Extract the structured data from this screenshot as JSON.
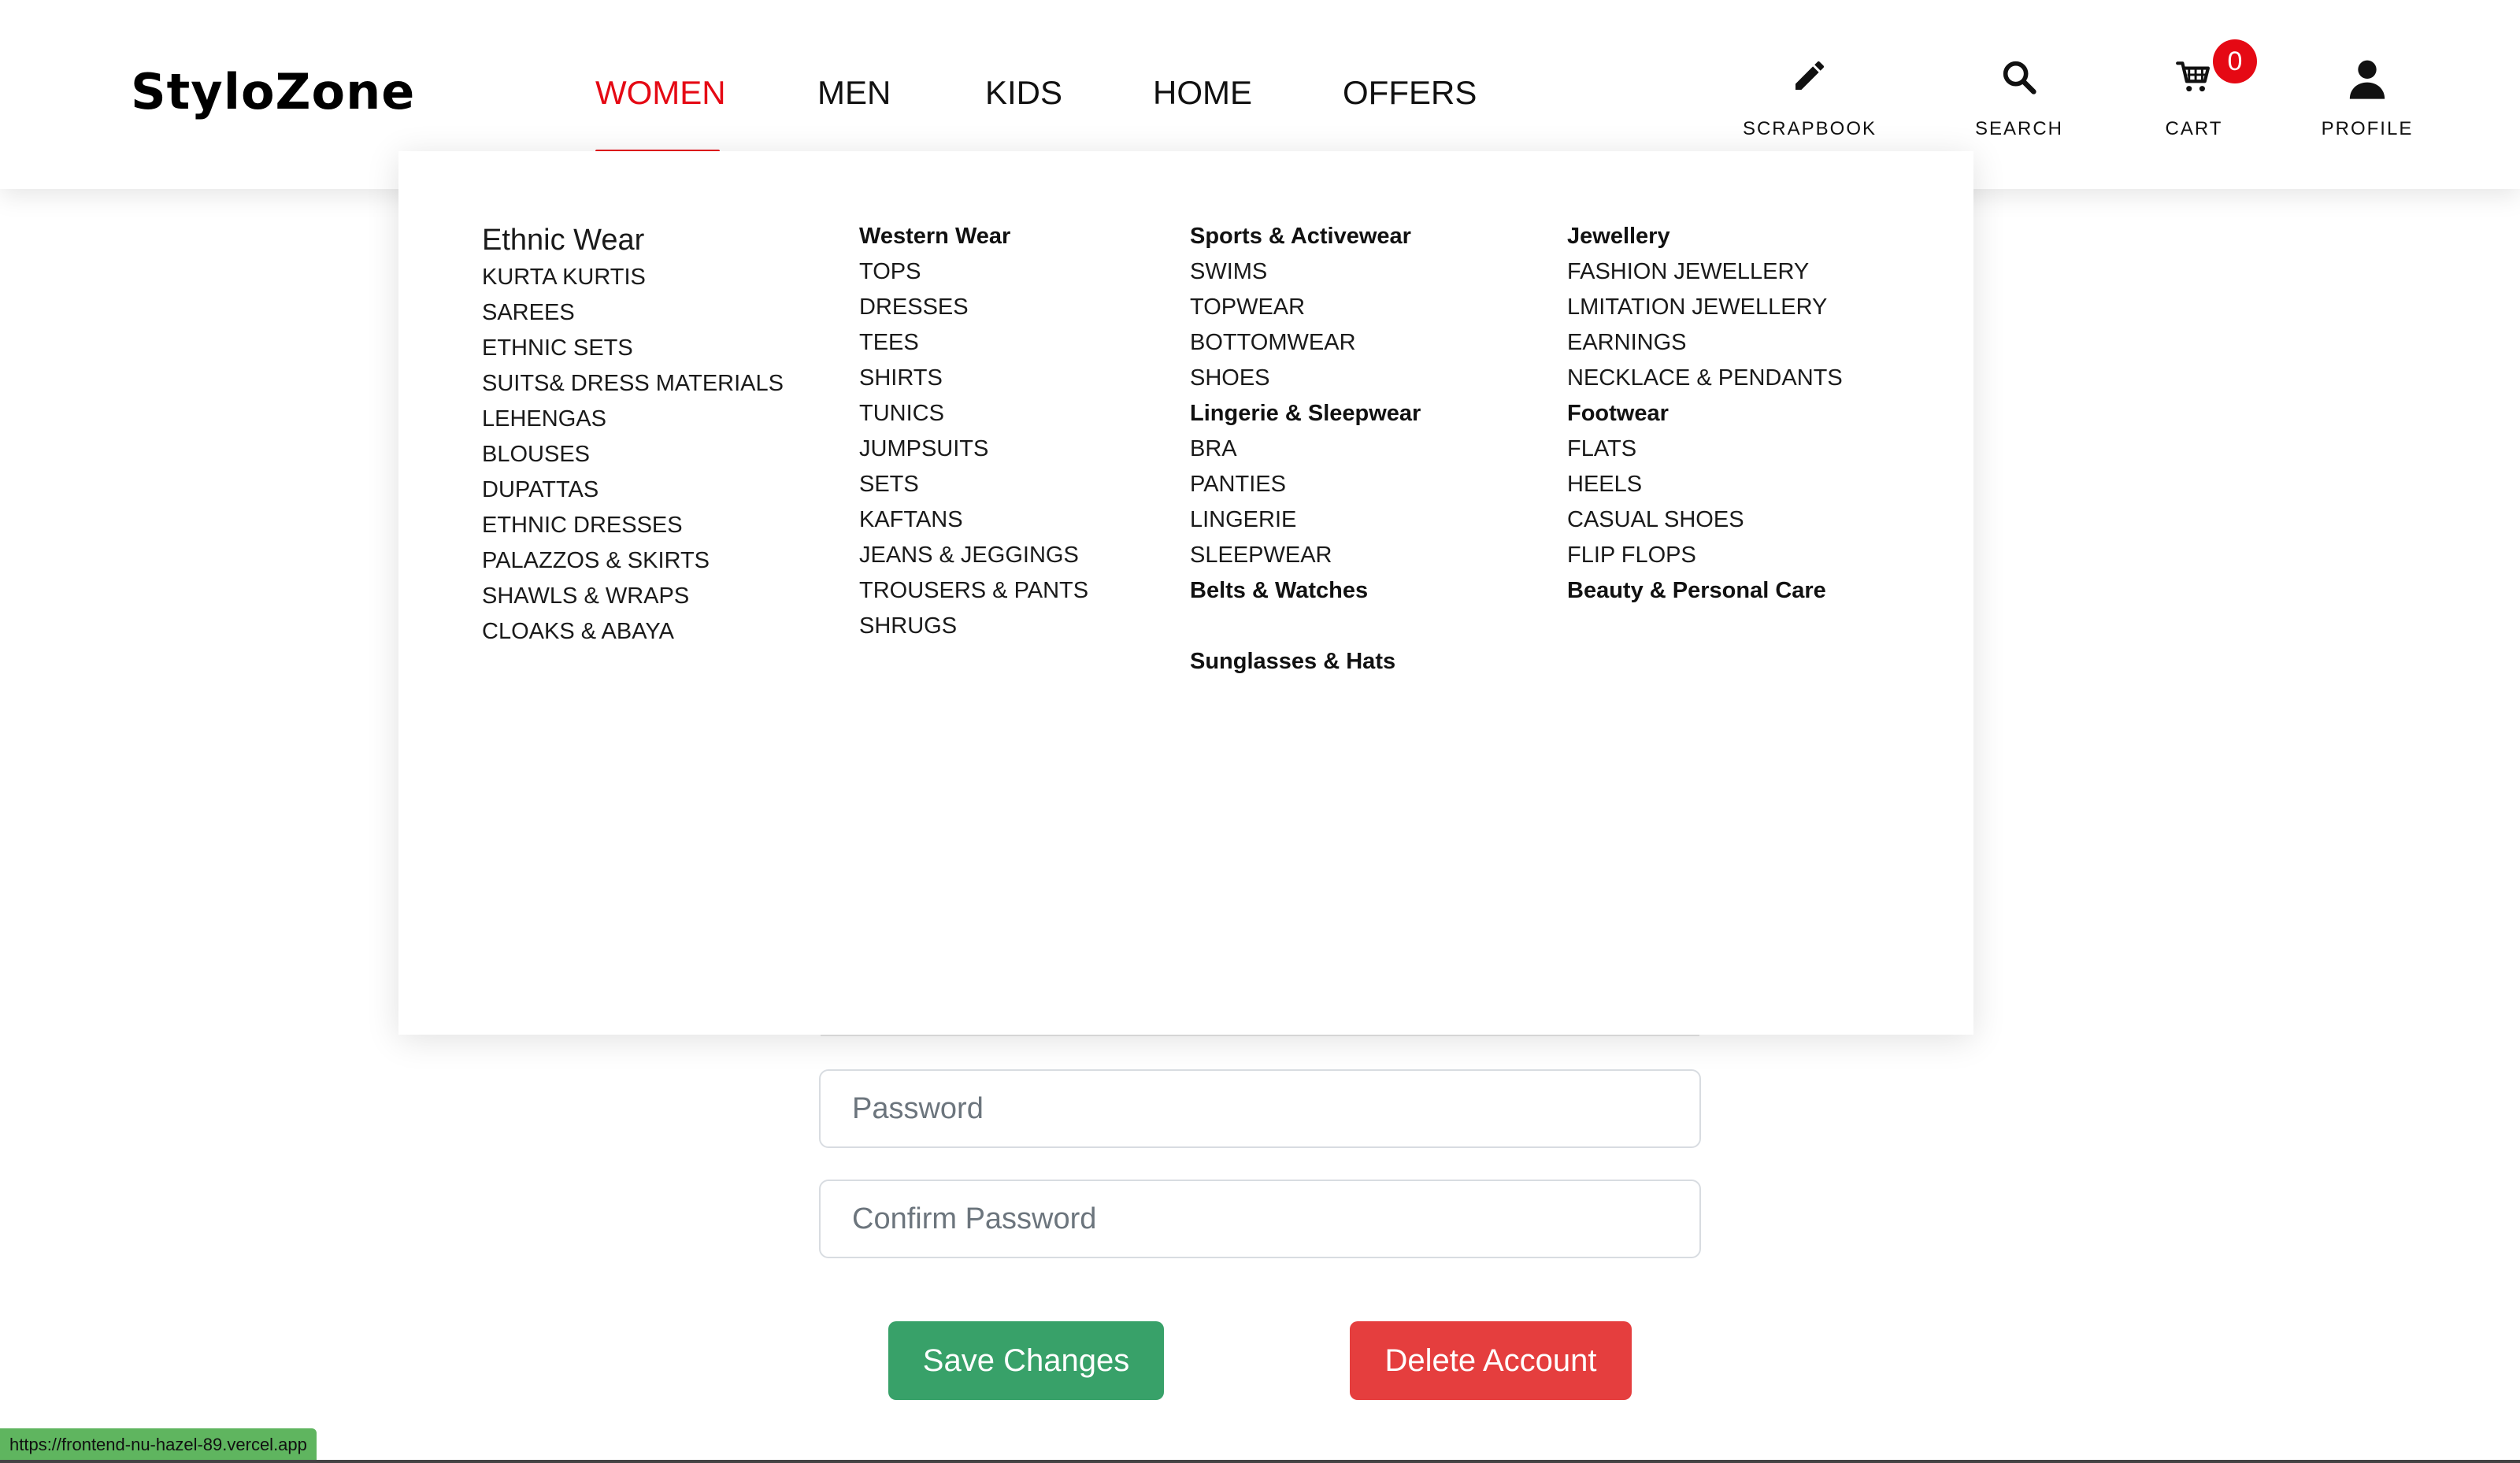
{
  "brand": {
    "name": "StyloZone",
    "accent": "#e50914"
  },
  "nav": {
    "items": [
      {
        "label": "WOMEN",
        "active": true
      },
      {
        "label": "MEN",
        "active": false
      },
      {
        "label": "KIDS",
        "active": false
      },
      {
        "label": "HOME",
        "active": false
      },
      {
        "label": "OFFERS",
        "active": false
      }
    ]
  },
  "actions": {
    "scrapbook": {
      "label": "SCRAPBOOK",
      "icon": "pencil-icon"
    },
    "search": {
      "label": "SEARCH",
      "icon": "search-icon"
    },
    "cart": {
      "label": "CART",
      "icon": "cart-icon",
      "count": "0"
    },
    "profile": {
      "label": "PROFILE",
      "icon": "user-icon"
    }
  },
  "mega_menu": {
    "columns": [
      {
        "heading": "Ethnic Wear",
        "items": [
          "KURTA KURTIS",
          "SAREES",
          "ETHNIC SETS",
          "SUITS& DRESS MATERIALS",
          "LEHENGAS",
          "BLOUSES",
          "DUPATTAS",
          "ETHNIC DRESSES",
          "PALAZZOS & SKIRTS",
          "SHAWLS & WRAPS",
          "CLOAKS & ABAYA"
        ]
      },
      {
        "heading": "Western Wear",
        "items": [
          "TOPS",
          "DRESSES",
          "TEES",
          "SHIRTS",
          "TUNICS",
          "JUMPSUITS",
          "SETS",
          "KAFTANS",
          "JEANS & JEGGINGS",
          "TROUSERS & PANTS",
          "SHRUGS"
        ]
      },
      {
        "heading": "Sports & Activewear",
        "items": [
          "SWIMS",
          "TOPWEAR",
          "BOTTOMWEAR",
          "SHOES"
        ],
        "heading2": "Lingerie & Sleepwear",
        "items2": [
          "BRA",
          "PANTIES",
          "LINGERIE",
          "SLEEPWEAR"
        ],
        "heading3": "Belts & Watches",
        "heading4": "Sunglasses & Hats"
      },
      {
        "heading": "Jewellery",
        "items": [
          "FASHION JEWELLERY",
          "LMITATION JEWELLERY",
          "EARNINGS",
          "NECKLACE & PENDANTS"
        ],
        "heading2": "Footwear",
        "items2": [
          "FLATS",
          "HEELS",
          "CASUAL SHOES",
          "FLIP FLOPS"
        ],
        "heading3": "Beauty & Personal Care"
      }
    ]
  },
  "form": {
    "password_placeholder": "Password",
    "confirm_placeholder": "Confirm Password",
    "save_label": "Save Changes",
    "delete_label": "Delete Account",
    "save_color": "#38a169",
    "delete_color": "#e53e3e"
  },
  "status_bar": {
    "url": "https://frontend-nu-hazel-89.vercel.app"
  }
}
